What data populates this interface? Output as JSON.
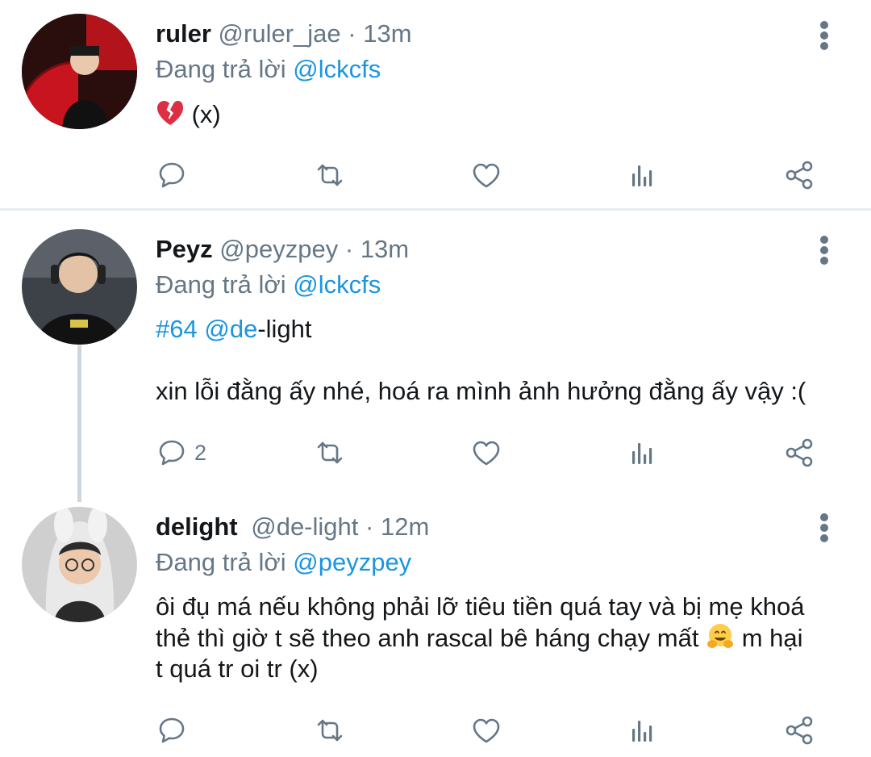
{
  "tweets": [
    {
      "name": "ruler",
      "handle": "@ruler_jae",
      "dot": "·",
      "time": "13m",
      "reply_prefix": "Đang trả lời",
      "reply_to": "@lckcfs",
      "text_after_emoji": " (x)",
      "emoji": "broken-heart",
      "actions": {
        "reply_count": "",
        "retweet_count": "",
        "like_count": ""
      }
    },
    {
      "name": "Peyz",
      "handle": "@peyzpey",
      "dot": "·",
      "time": "13m",
      "reply_prefix": "Đang trả lời",
      "reply_to": "@lckcfs",
      "hashtag": "#64",
      "mention": "@de",
      "mention_rest": "-light",
      "body": "xin lỗi đằng ấy nhé, hoá ra mình ảnh hưởng đằng ấy vậy :(",
      "actions": {
        "reply_count": "2"
      }
    },
    {
      "name": "delight",
      "handle": "@de-light",
      "dot": "·",
      "time": "12m",
      "reply_prefix": "Đang trả lời",
      "reply_to": "@peyzpey",
      "body_line1": "ôi đụ má nếu không phải lỡ tiêu tiền quá tay và bị mẹ khoá",
      "body_line2a": "thẻ thì giờ t sẽ theo anh rascal bê háng chạy mất ",
      "body_line2b": " m hại",
      "body_line3": "t quá tr oi tr (x)",
      "emoji": "hugging-face"
    }
  ],
  "colors": {
    "link": "#1b95e0",
    "muted": "#657786",
    "text": "#14171a",
    "divider": "#e6ecf0",
    "thread_line": "#ccd6dd"
  },
  "icons": [
    "reply-icon",
    "retweet-icon",
    "like-icon",
    "analytics-icon",
    "share-icon",
    "more-options-icon"
  ]
}
